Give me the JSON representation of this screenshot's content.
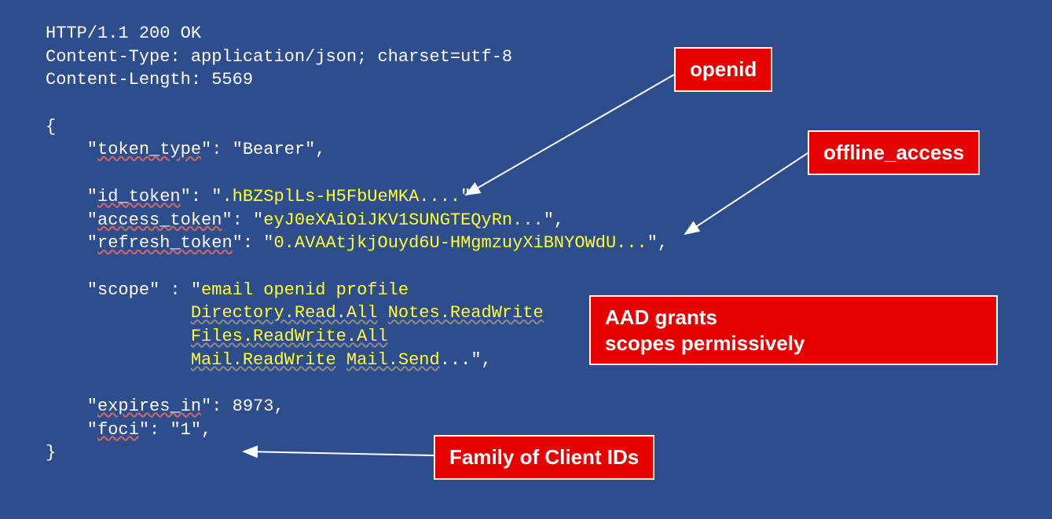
{
  "http": {
    "status_line": "HTTP/1.1 200 OK",
    "content_type_line": "Content-Type: application/json; charset=utf-8",
    "content_length_line": "Content-Length: 5569"
  },
  "json": {
    "open_brace": "{",
    "close_brace": "}",
    "token_type_key": "token_type",
    "token_type_val": "\"Bearer\",",
    "id_token_key": "id_token",
    "id_token_val": ".hBZSplLs-H5FbUeMKA....",
    "access_token_key": "access_token",
    "access_token_val": "eyJ0eXAiOiJKV1SUNGTEQyRn...",
    "refresh_token_key": "refresh_token",
    "refresh_token_val": "0.AVAAtjkjOuyd6U-HMgmzuyXiBNYOWdU...",
    "scope_key": "scope",
    "scope_line1": "email openid profile",
    "scope_line2a": "Directory.Read.All",
    "scope_line2b": "Notes.ReadWrite",
    "scope_line3": "Files.ReadWrite.All",
    "scope_line4a": "Mail.ReadWrite",
    "scope_line4b": "Mail.Send",
    "expires_in_key": "expires_in",
    "expires_in_val": "8973,",
    "foci_key": "foci",
    "foci_val": "\"1\","
  },
  "callouts": {
    "openid": "openid",
    "offline_access": "offline_access",
    "aad_line1": "AAD grants",
    "aad_line2": "scopes permissively",
    "foci": "Family of Client IDs"
  }
}
